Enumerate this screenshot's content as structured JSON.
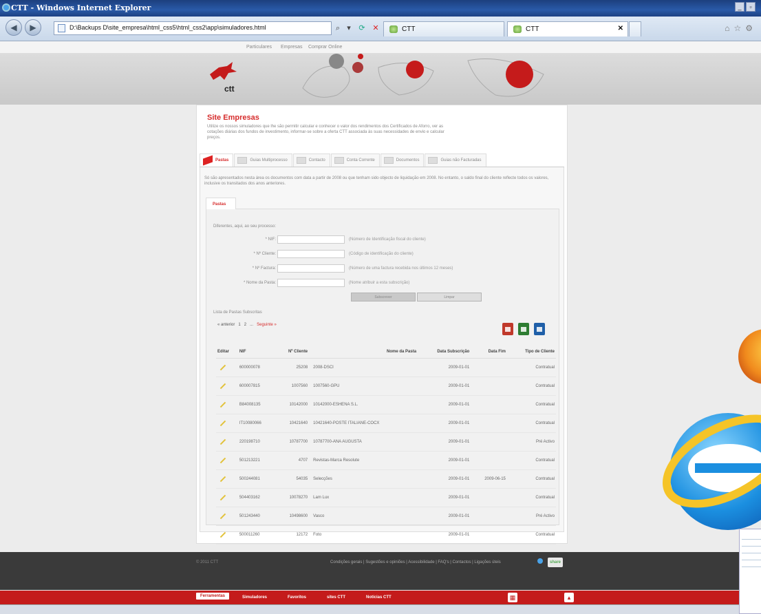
{
  "window": {
    "title": "CTT - Windows Internet Explorer"
  },
  "browser": {
    "url": "D:\\Backups D\\site_empresa\\html_css5\\html_css2\\app\\simuladores.html",
    "tabs": [
      {
        "label": "CTT"
      },
      {
        "label": "CTT"
      }
    ]
  },
  "topnav": {
    "items": [
      "Particulares",
      "Empresas",
      "Comprar Online"
    ]
  },
  "header": {
    "logo_text": "ctt"
  },
  "section": {
    "title": "Site Empresas",
    "description": "Utilize os nossos simuladores que lhe são permitir calcular e conhecer o valor dos rendimentos dos Certificados de Aforro, ver as cotações diárias dos fundos de investimento, informar-se sobre a oferta CTT associada às suas necessidades de envio e calcular preços."
  },
  "tabs": [
    {
      "label": "Pastas",
      "active": true
    },
    {
      "label": "Guias Multiprocesso",
      "active": false
    },
    {
      "label": "Contacto",
      "active": false
    },
    {
      "label": "Conta Corrente",
      "active": false
    },
    {
      "label": "Documentos",
      "active": false
    },
    {
      "label": "Guias não Facturadas",
      "active": false
    }
  ],
  "info_text": "Só são apresentados nesta área os documentos com data a partir de 2008 ou que tenham sido objecto de liquidação em 2008. No entanto, o saldo final do cliente reflecte todos os valores, inclusive os transitados dos anos anteriores.",
  "subtab": {
    "label": "Pastas"
  },
  "form": {
    "lead": "Diferentes, aqui, ao seu processo:",
    "fields": [
      {
        "label": "* NIF:",
        "hint": "(Número de Identificação fiscal do cliente)"
      },
      {
        "label": "* Nº Cliente:",
        "hint": "(Código de identificação do cliente)"
      },
      {
        "label": "* Nº Factura:",
        "hint": "(Número de uma factura recebida nos últimos 12 meses)"
      },
      {
        "label": "* Nome da Pasta:",
        "hint": "(Nome atribuir a esta subscrição)"
      }
    ],
    "submit_label": "Subscrever",
    "clear_label": "Limpar"
  },
  "list": {
    "label": "Lista de Pastas Subscritas",
    "pager": {
      "prev": "« anterior",
      "pages": [
        "1",
        "2",
        "..."
      ],
      "next": "Seguinte »"
    },
    "columns": [
      "Editar",
      "NIF",
      "Nº Cliente",
      "Nome da Pasta",
      "Data Subscrição",
      "Data Fim",
      "Tipo de Cliente"
    ],
    "rows": [
      {
        "nif": "600000078",
        "cliente": "25208",
        "nome": "2008-DSCI",
        "data": "2009-01-01",
        "fim": "",
        "tipo": "Contratual"
      },
      {
        "nif": "600007815",
        "cliente": "1007560",
        "nome": "1007560-GPU",
        "data": "2009-01-01",
        "fim": "",
        "tipo": "Contratual"
      },
      {
        "nif": "B84008135",
        "cliente": "10142000",
        "nome": "10142000-ESHENA S.L.",
        "data": "2009-01-01",
        "fim": "",
        "tipo": "Contratual"
      },
      {
        "nif": "IT10080066",
        "cliente": "10421640",
        "nome": "10421640-POSTE ITALIANE-COCX",
        "data": "2009-01-01",
        "fim": "",
        "tipo": "Contratual"
      },
      {
        "nif": "220198710",
        "cliente": "10787700",
        "nome": "10787700-ANA AUGUSTA",
        "data": "2009-01-01",
        "fim": "",
        "tipo": "Pré Activo"
      },
      {
        "nif": "501213221",
        "cliente": "4707",
        "nome": "Revistas-Marca Resolute",
        "data": "2009-01-01",
        "fim": "",
        "tipo": "Contratual"
      },
      {
        "nif": "500244081",
        "cliente": "54035",
        "nome": "Selecções",
        "data": "2009-01-01",
        "fim": "2009-06-15",
        "tipo": "Contratual"
      },
      {
        "nif": "504403162",
        "cliente": "10078270",
        "nome": "Lam Lux",
        "data": "2009-01-01",
        "fim": "",
        "tipo": "Contratual"
      },
      {
        "nif": "501243440",
        "cliente": "10498600",
        "nome": "Vasco",
        "data": "2009-01-01",
        "fim": "",
        "tipo": "Pré Activo"
      },
      {
        "nif": "500011260",
        "cliente": "12172",
        "nome": "Foto",
        "data": "2009-01-01",
        "fim": "",
        "tipo": "Contratual"
      }
    ]
  },
  "footer": {
    "copyright": "© 2011 CTT",
    "links": "Condições gerais | Sugestões e opiniões | Acessibilidade | FAQ's | Contactos | Ligações úteis",
    "share_label": "share"
  },
  "bottombar": {
    "items": [
      "Ferramentas",
      "Simuladores",
      "Favoritos",
      "sites CTT",
      "Notícias CTT"
    ]
  },
  "colors": {
    "brand_red": "#c41b1b",
    "accent_red": "#d62c2c"
  }
}
